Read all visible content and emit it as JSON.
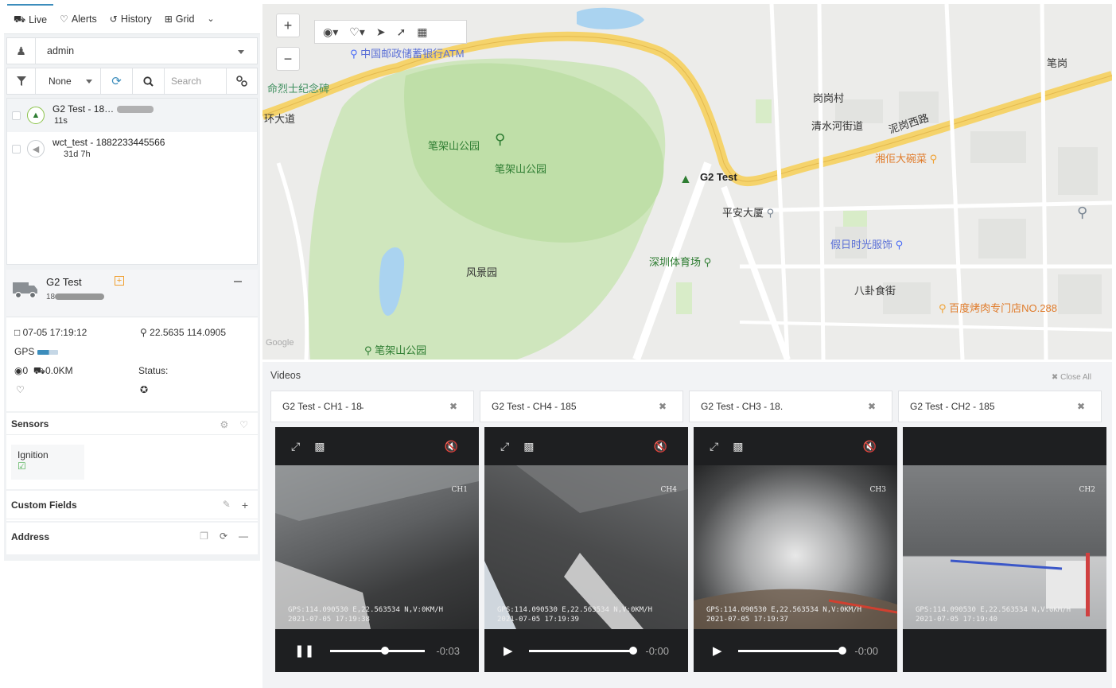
{
  "nav": {
    "tabs": [
      {
        "label": "Live",
        "icon": "truck-icon"
      },
      {
        "label": "Alerts",
        "icon": "bell-icon"
      },
      {
        "label": "History",
        "icon": "history-icon"
      },
      {
        "label": "Grid",
        "icon": "grid-icon"
      }
    ]
  },
  "account": {
    "value": "admin"
  },
  "filter": {
    "value": "None",
    "search_placeholder": "Search"
  },
  "objects": [
    {
      "name": "G2 Test - 18…",
      "sub": "11s"
    },
    {
      "name": "wct_test - 1882233445566",
      "sub": "31d 7h"
    }
  ],
  "detail": {
    "title": "G2 Test",
    "sub": "18",
    "datetime": "07-05 17:19:12",
    "coords": "22.5635 114.0905",
    "gps_label": "GPS",
    "gps_signal": 0.55,
    "speed": "0",
    "odometer": "0.0KM",
    "status_label": "Status:"
  },
  "sensors": {
    "title": "Sensors",
    "ignition": "Ignition"
  },
  "custom_fields": {
    "title": "Custom Fields"
  },
  "address": {
    "title": "Address"
  },
  "map": {
    "labels": {
      "atm": "中国邮政储蓄银行ATM",
      "memorial": "命烈士纪念碑",
      "ring_road": "环大道",
      "park1": "笔架山公园",
      "park2": "笔架山公园",
      "park3": "笔架山公园",
      "scenic": "风景园",
      "vehicle": "G2 Test",
      "village": "岗岗村",
      "street": "清水河街道",
      "west_road": "泥岗西路",
      "restaurant": "湘佢大碗菜",
      "pingan": "平安大厦",
      "holiday": "假日时光服饰",
      "stadium": "深圳体育场",
      "bagua": "八卦食街",
      "bbq": "百度烤肉专门店NO.288",
      "north": "笔岗",
      "google": "Google"
    }
  },
  "videos": {
    "title": "Videos",
    "close_all": "Close All",
    "players": [
      {
        "tab": "G2 Test - CH1 - 18̵",
        "ch": "CH1",
        "osd1": "GPS:114.090530 E,22.563534 N,V:0KM/H",
        "osd2": "2021-07-05 17:19:38",
        "time": "-0:03",
        "progress": 0.68,
        "playing": true
      },
      {
        "tab": "G2 Test - CH4 - 185",
        "ch": "CH4",
        "osd1": "GPS:114.090530 E,22.563534 N,V:0KM/H",
        "osd2": "2021-07-05 17:19:39",
        "time": "-0:00",
        "progress": 1.0,
        "playing": false
      },
      {
        "tab": "G2 Test - CH3 - 18.",
        "ch": "CH3",
        "osd1": "GPS:114.090530 E,22.563534 N,V:0KM/H",
        "osd2": "2021-07-05 17:19:37",
        "time": "-0:00",
        "progress": 1.0,
        "playing": false
      },
      {
        "tab": "G2 Test - CH2 - 185",
        "ch": "CH2",
        "osd1": "GPS:114.090530 E,22.563534 N,V:0KM/H",
        "osd2": "2021-07-05 17:19:40",
        "time": "",
        "progress": null,
        "playing": false
      }
    ]
  },
  "colors": {
    "accent": "#3c8dbc",
    "road_yellow": "#f5d36b",
    "park_green": "#c9e4b4",
    "player_bg": "#1e1f21"
  }
}
